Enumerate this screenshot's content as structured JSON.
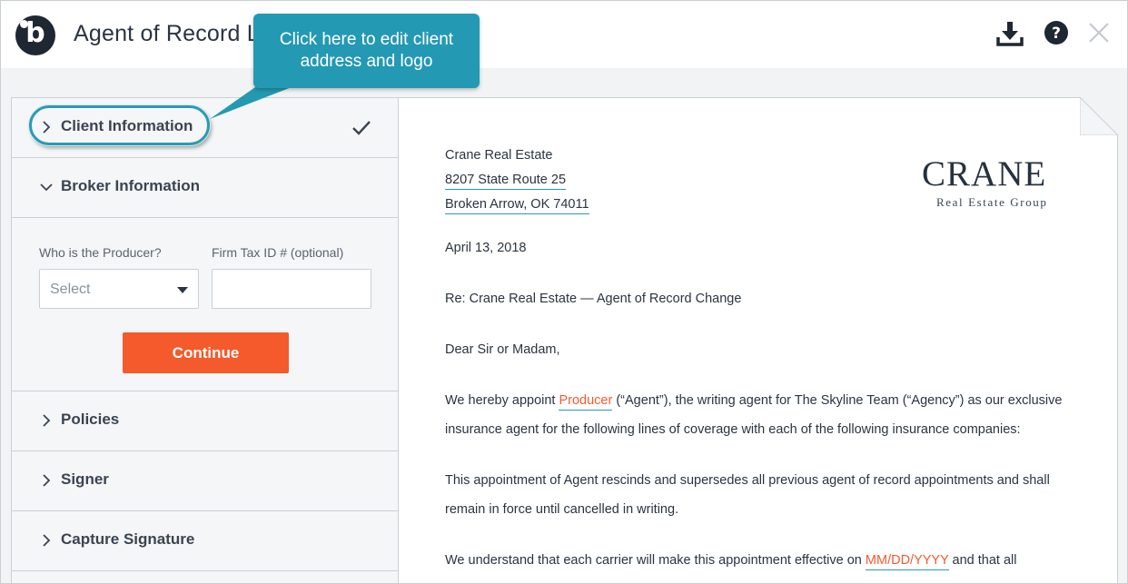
{
  "header": {
    "title": "Agent of Record L",
    "logo_letter": "b",
    "download_icon": "download-icon",
    "help_icon": "help-icon",
    "close_icon": "close-icon"
  },
  "tooltip": {
    "line1": "Click here to edit client",
    "line2": "address and logo"
  },
  "sidebar": {
    "items": [
      {
        "label": "Client Information",
        "state": "collapsed",
        "completed": true
      },
      {
        "label": "Broker Information",
        "state": "expanded"
      },
      {
        "label": "Policies",
        "state": "collapsed"
      },
      {
        "label": "Signer",
        "state": "collapsed"
      },
      {
        "label": "Capture Signature",
        "state": "collapsed"
      }
    ],
    "broker_form": {
      "producer_label": "Who is the Producer?",
      "producer_value": "Select",
      "tax_label": "Firm Tax ID # (optional)",
      "tax_value": "",
      "continue_label": "Continue"
    }
  },
  "document": {
    "client_name": "Crane Real Estate",
    "address_line1": "8207 State Route 25",
    "address_line2": "Broken Arrow, OK 74011",
    "date": "April 13, 2018",
    "re_line": "Re: Crane Real Estate — Agent of Record Change",
    "salutation": "Dear Sir or Madam,",
    "p1_before": "We hereby appoint ",
    "p1_field": "Producer",
    "p1_after": " (“Agent”), the writing agent for The Skyline Team (“Agency”) as our exclusive",
    "p1_line2": "insurance agent for the following lines of coverage with each of the following insurance companies:",
    "p2_line1": "This appointment of Agent rescinds and supersedes all previous agent of record appointments and shall",
    "p2_line2": "remain in force until cancelled in writing.",
    "p3_before": "We understand that each carrier will make this appointment effective on ",
    "p3_field": "MM/DD/YYYY",
    "p3_after": " and that all",
    "logo_word": "CRANE",
    "logo_sub": "Real Estate Group"
  },
  "colors": {
    "accent": "#2499b3",
    "button": "#f45a2c",
    "text": "#2b3442"
  }
}
